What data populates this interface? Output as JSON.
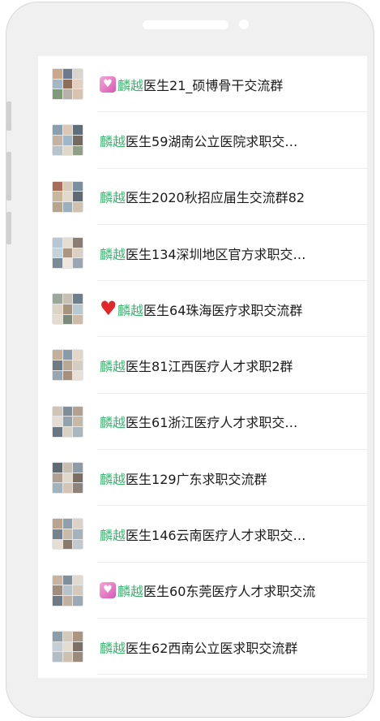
{
  "brand": "麟越",
  "chats": [
    {
      "emoji": "pink-heart",
      "name": "医生21_硕博骨干交流群"
    },
    {
      "emoji": "",
      "name": "医生59湖南公立医院求职交…"
    },
    {
      "emoji": "",
      "name": "医生2020秋招应届生交流群82"
    },
    {
      "emoji": "",
      "name": "医生134深圳地区官方求职交…"
    },
    {
      "emoji": "red-heart",
      "name": "医生64珠海医疗求职交流群"
    },
    {
      "emoji": "",
      "name": "医生81江西医疗人才求职2群"
    },
    {
      "emoji": "",
      "name": "医生61浙江医疗人才求职交…"
    },
    {
      "emoji": "",
      "name": "医生129广东求职交流群"
    },
    {
      "emoji": "",
      "name": "医生146云南医疗人才求职交…"
    },
    {
      "emoji": "pink-heart",
      "name": "医生60东莞医疗人才求职交流"
    },
    {
      "emoji": "",
      "name": "医生62西南公立医求职交流群"
    }
  ],
  "colors": {
    "brand": "#3cb371",
    "text": "#1a1a1a",
    "divider": "#ececec"
  }
}
